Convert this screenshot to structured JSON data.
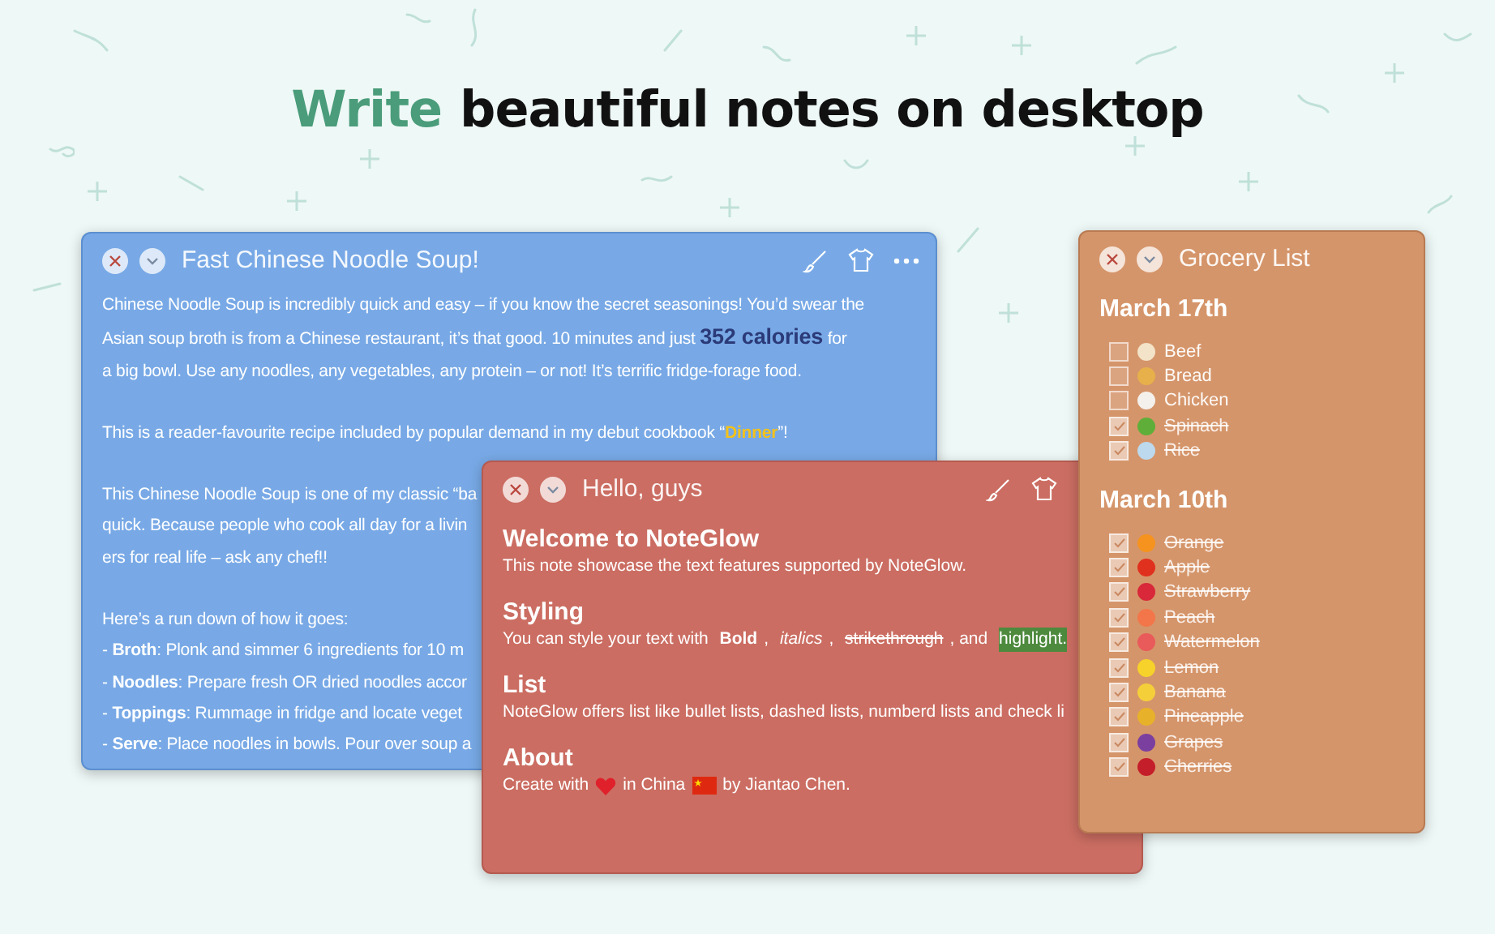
{
  "headline": {
    "accent": "Write",
    "rest": "beautiful notes on desktop"
  },
  "recipe_note": {
    "title": "Fast Chinese Noodle Soup!",
    "paragraphs": [
      {
        "kind": "large",
        "lines": [
          "Chinese Noodle Soup is incredibly quick and easy – if you know the secret seasonings! You’d swear the",
          "Asian soup broth is from a Chinese restaurant, it’s that good. 10 minutes and just **352 calories** for",
          "a big bowl. Use any noodles, any vegetables, any protein – or not! It’s terrific fridge-forage food."
        ]
      },
      {
        "kind": "colored",
        "lines": [
          "This is a reader-favourite recipe included by popular demand in my debut cookbook “**Dinner**”!"
        ]
      },
      {
        "kind": "plain",
        "lines": [
          "This Chinese Noodle Soup is one of my classic “ba",
          "quick. Because people who cook all day for a livin",
          "ers for real life – ask any chef!!"
        ]
      },
      {
        "kind": "plain",
        "lines": [
          "Here’s a run down of how it goes:",
          " - **Broth**: Plonk and simmer 6 ingredients for 10 m",
          " - **Noodles**: Prepare fresh OR dried noodles accor",
          " - **Toppings**: Rummage in fridge and locate veget",
          " - **Serve**: Place noodles in bowls. Pour over soup a"
        ]
      }
    ]
  },
  "welcome_note": {
    "title": "Hello, guys",
    "sections": [
      {
        "heading": "Welcome to NoteGlow",
        "parts": [
          {
            "kind": "plain",
            "text": "This note showcase the text features supported by NoteGlow."
          }
        ]
      },
      {
        "heading": "Styling",
        "parts": [
          {
            "kind": "plain",
            "text": "You can style your text with "
          },
          {
            "kind": "bold",
            "text": "Bold"
          },
          {
            "kind": "plain",
            "text": ", "
          },
          {
            "kind": "italic",
            "text": "italics"
          },
          {
            "kind": "plain",
            "text": ", "
          },
          {
            "kind": "strike",
            "text": "strikethrough"
          },
          {
            "kind": "plain",
            "text": ", and "
          },
          {
            "kind": "highlight",
            "text": "highlight."
          }
        ]
      },
      {
        "heading": "List",
        "parts": [
          {
            "kind": "plain",
            "text": "NoteGlow offers list like bullet lists, dashed lists, numberd lists and check li"
          }
        ]
      },
      {
        "heading": "About",
        "parts": [
          {
            "kind": "plain",
            "text": "Create with"
          },
          {
            "kind": "heart"
          },
          {
            "kind": "plain",
            "text": "in China"
          },
          {
            "kind": "flag"
          },
          {
            "kind": "plain",
            "text": "by Jiantao Chen."
          }
        ]
      }
    ]
  },
  "grocery_note": {
    "title": "Grocery List",
    "sections": [
      {
        "heading": "March 17th",
        "items": [
          {
            "label": "Beef",
            "checked": false,
            "color": "#f3e3c8"
          },
          {
            "label": "Bread",
            "checked": false,
            "color": "#e8b04a"
          },
          {
            "label": "Chicken",
            "checked": false,
            "color": "#f4f1ec"
          },
          {
            "label": "Spinach",
            "checked": true,
            "color": "#5fae3a"
          },
          {
            "label": "Rice",
            "checked": true,
            "color": "#bcd9ee"
          }
        ]
      },
      {
        "heading": "March 10th",
        "items": [
          {
            "label": "Orange",
            "checked": true,
            "color": "#f5931e"
          },
          {
            "label": "Apple",
            "checked": true,
            "color": "#e0301e"
          },
          {
            "label": "Strawberry",
            "checked": true,
            "color": "#d8283a"
          },
          {
            "label": "Peach",
            "checked": true,
            "color": "#f2764a"
          },
          {
            "label": "Watermelon",
            "checked": true,
            "color": "#e95a5a"
          },
          {
            "label": "Lemon",
            "checked": true,
            "color": "#f6d22a"
          },
          {
            "label": "Banana",
            "checked": true,
            "color": "#f5cf3a"
          },
          {
            "label": "Pineapple",
            "checked": true,
            "color": "#e8b12a"
          },
          {
            "label": "Grapes",
            "checked": true,
            "color": "#7b3fa0"
          },
          {
            "label": "Cherries",
            "checked": true,
            "color": "#c41e2a"
          }
        ]
      }
    ]
  }
}
